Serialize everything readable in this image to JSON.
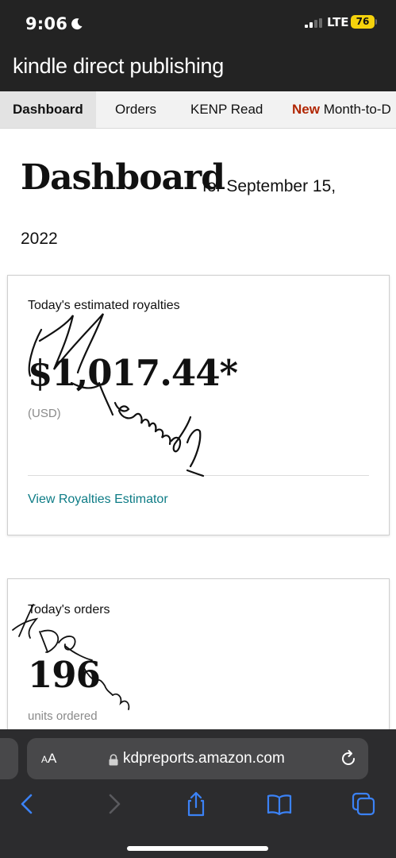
{
  "status_bar": {
    "time": "9:06",
    "network": "LTE",
    "battery": "76"
  },
  "header": {
    "brand": "kindle direct publishing"
  },
  "tabs": [
    {
      "label": "Dashboard"
    },
    {
      "label": "Orders"
    },
    {
      "label": "KENP Read"
    },
    {
      "badge": "New",
      "label": "Month-to-D"
    }
  ],
  "page": {
    "title": "Dashboard",
    "date_line1": "for September 15,",
    "date_line2": "2022"
  },
  "royalties_card": {
    "label": "Today's estimated royalties",
    "value": "$1,017.44*",
    "currency": "(USD)",
    "link": "View Royalties Estimator"
  },
  "orders_card": {
    "label": "Today's orders",
    "value": "196",
    "unit_label": "units ordered"
  },
  "browser": {
    "text_size_label_small": "A",
    "text_size_label_large": "A",
    "url": "kdpreports.amazon.com"
  },
  "icons": [
    "moon-icon",
    "signal-icon",
    "lock-icon",
    "reload-icon",
    "back-icon",
    "forward-icon",
    "share-icon",
    "bookmarks-icon",
    "tabs-icon"
  ],
  "colors": {
    "header_bg": "#232323",
    "new_badge": "#b12704",
    "link": "#0e7c86",
    "safari_bg": "#2c2c2e",
    "battery": "#f5d20c"
  }
}
